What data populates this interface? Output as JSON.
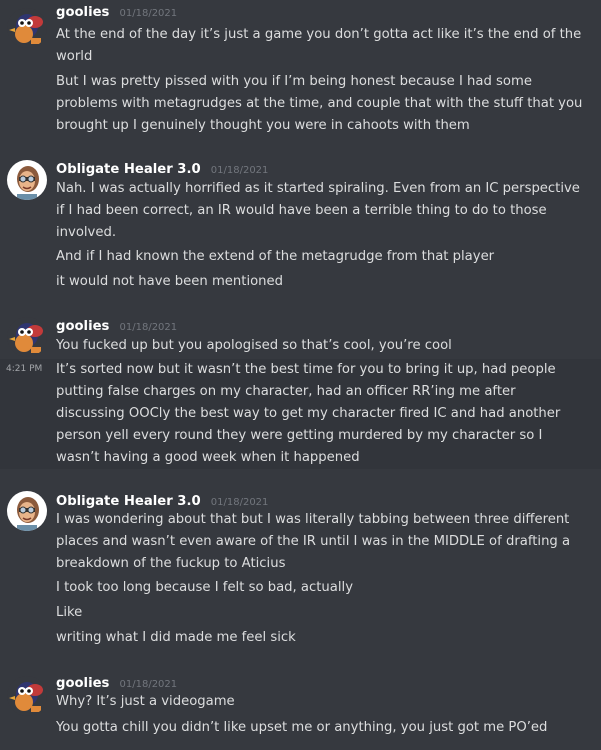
{
  "groups": [
    {
      "username": "goolies",
      "timestamp": "01/18/2021",
      "avatar_icon": "penguin-avatar-icon",
      "messages": [
        "At the end of the day it’s just a game you don’t gotta act like it’s the end of the world",
        "But I was pretty pissed with you if I’m being honest because I had some problems with metagrudges at the time, and couple that with the stuff that you brought up I genuinely thought you were in cahoots with them"
      ]
    },
    {
      "username": "Obligate Healer 3.0",
      "timestamp": "01/18/2021",
      "avatar_icon": "character-portrait-avatar-icon",
      "messages": [
        "Nah. I was actually horrified as it started spiraling. Even from an IC perspective if I had been correct, an IR would have been a terrible thing to do to those involved.",
        "And if I had known the extend of the metagrudge from that player",
        "it would not have been mentioned"
      ]
    },
    {
      "username": "goolies",
      "timestamp": "01/18/2021",
      "avatar_icon": "penguin-avatar-icon",
      "messages": [
        "You fucked up but you apologised so that’s cool, you’re cool",
        "It’s sorted now but it wasn’t the best time for you to bring it up, had people putting false charges on my character, had an officer RR’ing me after discussing OOCly the best way to get my character fired IC and had another person yell every round they were getting murdered by my character so I wasn’t having a good week when it happened"
      ],
      "hover_time": "4:21 PM"
    },
    {
      "username": "Obligate Healer 3.0",
      "timestamp": "01/18/2021",
      "avatar_icon": "character-portrait-avatar-icon",
      "messages": [
        "I was wondering about that but I was literally tabbing between three different places and wasn’t even aware of the IR until I was in the MIDDLE of drafting a breakdown of the fuckup to Aticius",
        "I took too long because I felt so bad, actually",
        "Like",
        "writing what I did made me feel sick"
      ]
    },
    {
      "username": "goolies",
      "timestamp": "01/18/2021",
      "avatar_icon": "penguin-avatar-icon",
      "messages": [
        "Why? It’s just a videogame",
        "You gotta chill you didn’t like upset me or anything, you just got me PO’ed"
      ]
    }
  ]
}
